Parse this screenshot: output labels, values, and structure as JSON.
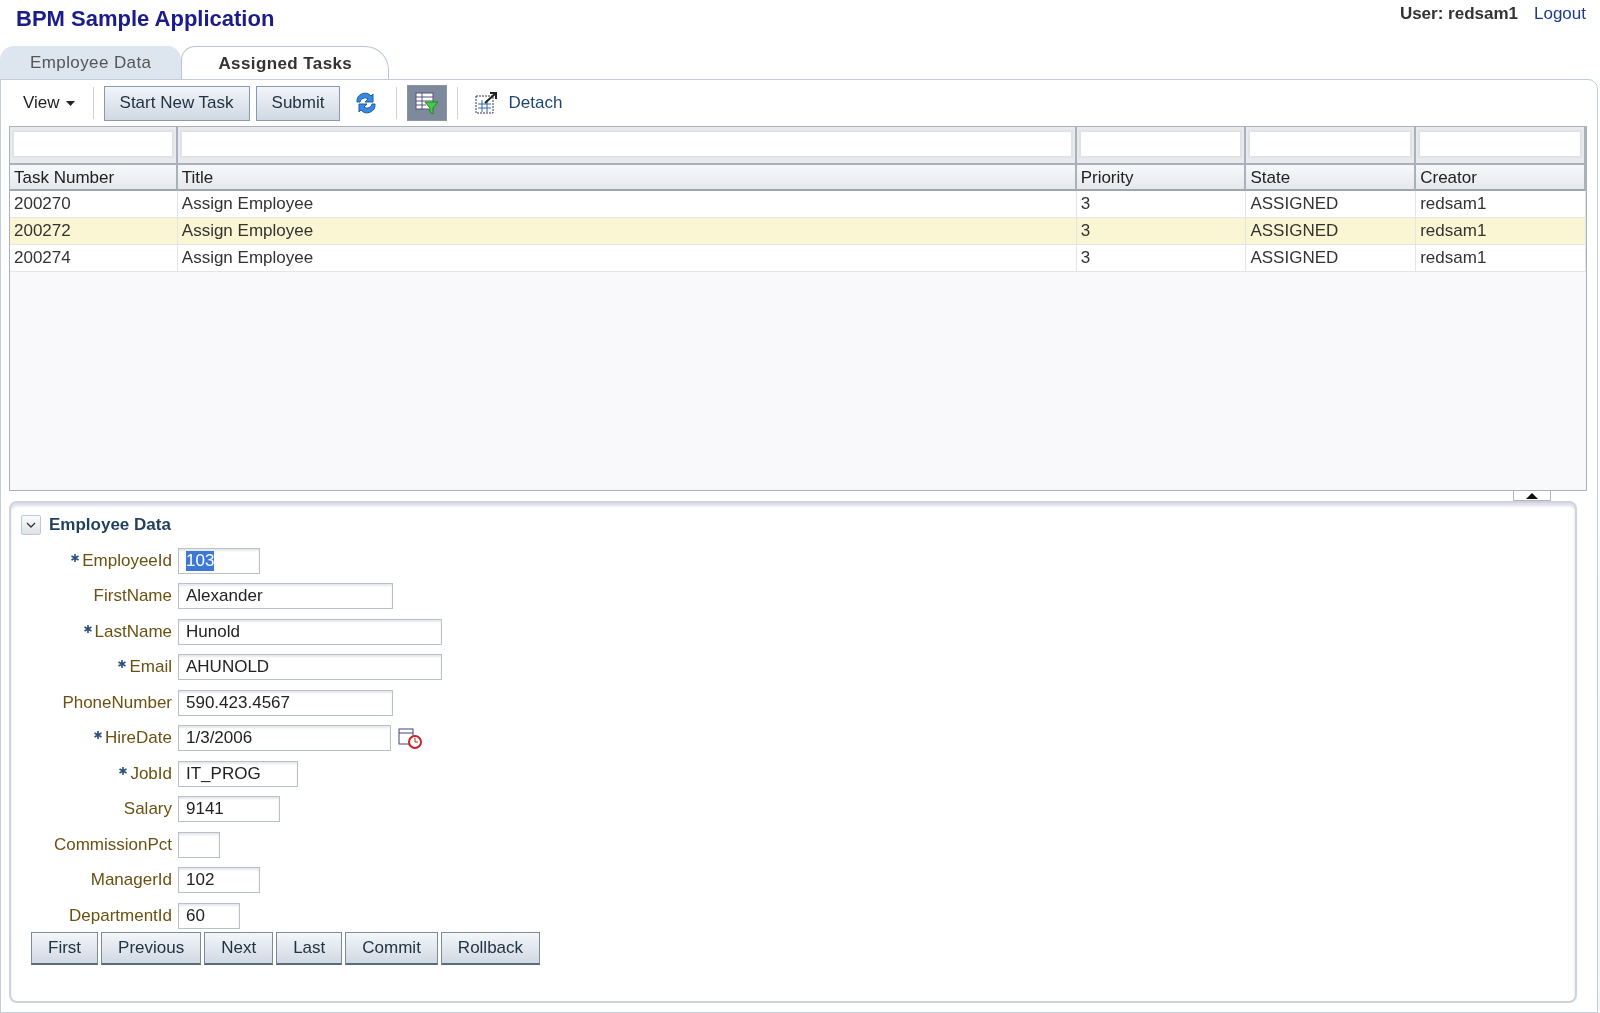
{
  "app_title": "BPM Sample Application",
  "user": {
    "label": "User: redsam1",
    "logout": "Logout"
  },
  "tabs": [
    {
      "label": "Employee Data",
      "selected": false
    },
    {
      "label": "Assigned Tasks",
      "selected": true
    }
  ],
  "toolbar": {
    "view_menu": "View",
    "buttons": [
      "Start New Task",
      "Submit"
    ],
    "filter_on": true,
    "detach": "Detach"
  },
  "table": {
    "columns": [
      "Task Number",
      "Title",
      "Priority",
      "State",
      "Creator"
    ],
    "rows": [
      {
        "cells": [
          "200270",
          "Assign Employee",
          "3",
          "ASSIGNED",
          "redsam1"
        ],
        "selected": false
      },
      {
        "cells": [
          "200272",
          "Assign Employee",
          "3",
          "ASSIGNED",
          "redsam1"
        ],
        "selected": true
      },
      {
        "cells": [
          "200274",
          "Assign Employee",
          "3",
          "ASSIGNED",
          "redsam1"
        ],
        "selected": false
      }
    ]
  },
  "panel": {
    "title": "Employee Data",
    "expanded": true,
    "fields": [
      {
        "label": "EmployeeId",
        "value": "103",
        "required": true,
        "text_selected": true
      },
      {
        "label": "FirstName",
        "value": "Alexander",
        "required": false
      },
      {
        "label": "LastName",
        "value": "Hunold",
        "required": true
      },
      {
        "label": "Email",
        "value": "AHUNOLD",
        "required": true
      },
      {
        "label": "PhoneNumber",
        "value": "590.423.4567",
        "required": false
      },
      {
        "label": "HireDate",
        "value": "1/3/2006",
        "required": true,
        "kind": "date"
      },
      {
        "label": "JobId",
        "value": "IT_PROG",
        "required": true
      },
      {
        "label": "Salary",
        "value": "9141",
        "required": false
      },
      {
        "label": "CommissionPct",
        "required": false
      },
      {
        "label": "ManagerId",
        "value": "102",
        "required": false
      },
      {
        "label": "DepartmentId",
        "value": "60",
        "required": false
      }
    ],
    "buttons": [
      "First",
      "Previous",
      "Next",
      "Last",
      "Commit",
      "Rollback"
    ]
  }
}
